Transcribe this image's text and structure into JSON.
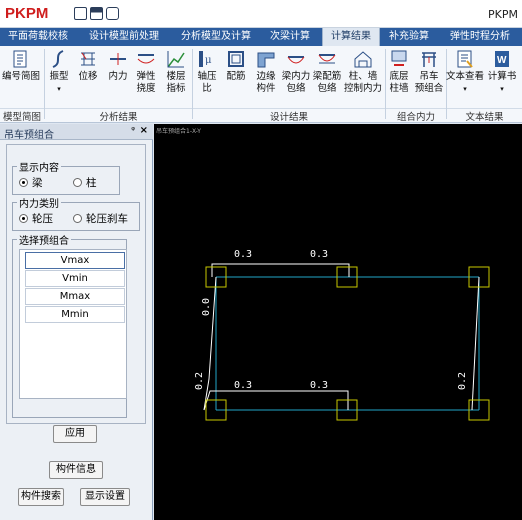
{
  "app": {
    "logo": "PKPM",
    "title": "PKPM"
  },
  "tabs": [
    {
      "label": "平面荷载校核"
    },
    {
      "label": "设计模型前处理"
    },
    {
      "label": "分析模型及计算"
    },
    {
      "label": "次梁计算"
    },
    {
      "label": "计算结果"
    },
    {
      "label": "补充验算"
    },
    {
      "label": "弹性时程分析"
    }
  ],
  "ribbon": {
    "buttons": [
      {
        "label": "编号简图"
      },
      {
        "label": "振型"
      },
      {
        "label": "位移"
      },
      {
        "label": "内力"
      },
      {
        "label": "弹性\n挠度"
      },
      {
        "label": "楼层\n指标"
      },
      {
        "label": "轴压比"
      },
      {
        "label": "配筋"
      },
      {
        "label": "边缘\n构件"
      },
      {
        "label": "梁内力\n包络"
      },
      {
        "label": "梁配筋\n包络"
      },
      {
        "label": "柱、墙\n控制内力"
      },
      {
        "label": "底层\n柱墙"
      },
      {
        "label": "吊车\n预组合"
      },
      {
        "label": "文本查看"
      },
      {
        "label": "计算书"
      }
    ],
    "groups": [
      {
        "label": "模型简图"
      },
      {
        "label": "分析结果"
      },
      {
        "label": "设计结果"
      },
      {
        "label": "组合内力"
      },
      {
        "label": "文本结果"
      }
    ]
  },
  "panel": {
    "title": "吊车预组合",
    "pin": "ᵠ",
    "close": "×",
    "display": {
      "legend": "显示内容",
      "opt1": "梁",
      "opt2": "柱"
    },
    "force": {
      "legend": "内力类别",
      "opt1": "轮压",
      "opt2": "轮压刹车"
    },
    "combo": {
      "legend": "选择预组合",
      "items": [
        "Vmax",
        "Vmin",
        "Mmax",
        "Mmin"
      ]
    },
    "apply": "应用",
    "info": "构件信息",
    "search": "构件搜索",
    "settings": "显示设置"
  },
  "canvas": {
    "label": "吊车预组合1-X-Y",
    "values": {
      "top_left_beam": "0.3",
      "top_right_beam": "0.3",
      "bottom_left_beam": "0.3",
      "bottom_right_beam": "0.3",
      "left_col_upper": "0.0",
      "left_col_lower": "0.2",
      "right_col_lower": "0.2"
    }
  }
}
